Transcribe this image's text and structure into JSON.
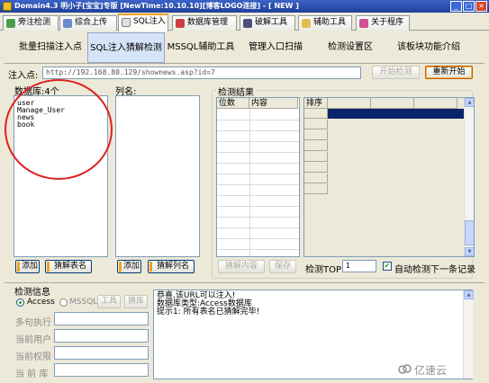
{
  "window": {
    "title": "Domain4.3 明小子[宝宝]专版 [NewTime:10.10.10][博客LOGO连接] - [ NEW ]",
    "minimize": "_",
    "maximize": "□",
    "close": "×"
  },
  "tabs": [
    {
      "label": "旁注检测"
    },
    {
      "label": "综合上传"
    },
    {
      "label": "SQL注入"
    },
    {
      "label": "数据库管理"
    },
    {
      "label": "破解工具"
    },
    {
      "label": "辅助工具"
    },
    {
      "label": "关于程序"
    }
  ],
  "subtabs": [
    {
      "label": "批量扫描注入点"
    },
    {
      "label": "SQL注入猜解检测"
    },
    {
      "label": "MSSQL辅助工具"
    },
    {
      "label": "管理入口扫描"
    },
    {
      "label": "检测设置区"
    },
    {
      "label": "该板块功能介绍"
    }
  ],
  "inject": {
    "label": "注入点:",
    "url": "http://192.168.80.129/shownews.asp?id=7",
    "start_button": "开始检测",
    "restart_button": "重新开始"
  },
  "databases": {
    "label": "数据库:4个",
    "items": [
      "user",
      "Manage_User",
      "news",
      "book"
    ],
    "add_button": "添加",
    "guess_button": "猜解表名"
  },
  "columns": {
    "label": "列名:",
    "add_button": "添加",
    "guess_button": "猜解列名"
  },
  "results": {
    "label": "检测结果",
    "col_position": "位数",
    "col_content": "内容",
    "guess_content_button": "猜解内容",
    "save_button": "保存",
    "top_label": "检测TOP:",
    "top_value": "1",
    "auto_next_label": "自动检测下一条记录",
    "auto_next_checked": true
  },
  "sort": {
    "header": "排序"
  },
  "info": {
    "title": "检测信息",
    "type_access": "Access",
    "type_mssql": "MSSQL",
    "tools_button": "工具",
    "guess_button": "猜库",
    "selected_type": "Access",
    "multi_sentence": "多句执行",
    "current_user": "当前用户",
    "current_priv": "当前权限",
    "current_db": "当 前 库",
    "messages": [
      "恭喜,该URL可以注入!",
      "数据库类型:Access数据库",
      "提示1: 所有表名已猜解完毕!"
    ]
  },
  "watermark": "亿速云",
  "colors": {
    "accent_tab": "#f0a020",
    "annotation_circle": "#e02020",
    "sort_highlight": "#0a246a",
    "title_bar": "#2c52b8"
  }
}
